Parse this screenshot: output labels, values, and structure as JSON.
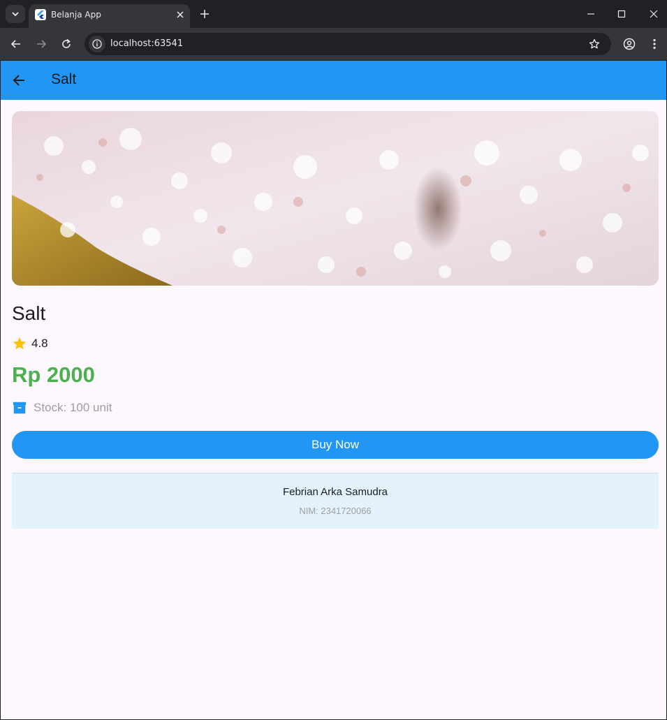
{
  "browser": {
    "tab_title": "Belanja App",
    "url": "localhost:63541",
    "icons": [
      "tab-search-icon",
      "flutter-favicon-icon",
      "close-icon",
      "plus-icon",
      "minimize-icon",
      "maximize-icon",
      "close-window-icon",
      "back-arrow-icon",
      "forward-arrow-icon",
      "reload-icon",
      "site-info-icon",
      "bookmark-star-icon",
      "profile-icon",
      "kebab-menu-icon"
    ]
  },
  "appbar": {
    "title": "Salt",
    "back_icon": "arrow-back-icon",
    "color": "#2196f3"
  },
  "product": {
    "image": "photo of coarse pink and white salt crystals",
    "name": "Salt",
    "rating": "4.8",
    "rating_icon": "star-icon",
    "price": "Rp 2000",
    "price_color": "#4caf50",
    "stock": "Stock: 100 unit",
    "stock_icon": "inventory-box-icon"
  },
  "actions": {
    "buy_label": "Buy Now"
  },
  "footer": {
    "name": "Febrian Arka Samudra",
    "nim": "NIM: 2341720066"
  }
}
